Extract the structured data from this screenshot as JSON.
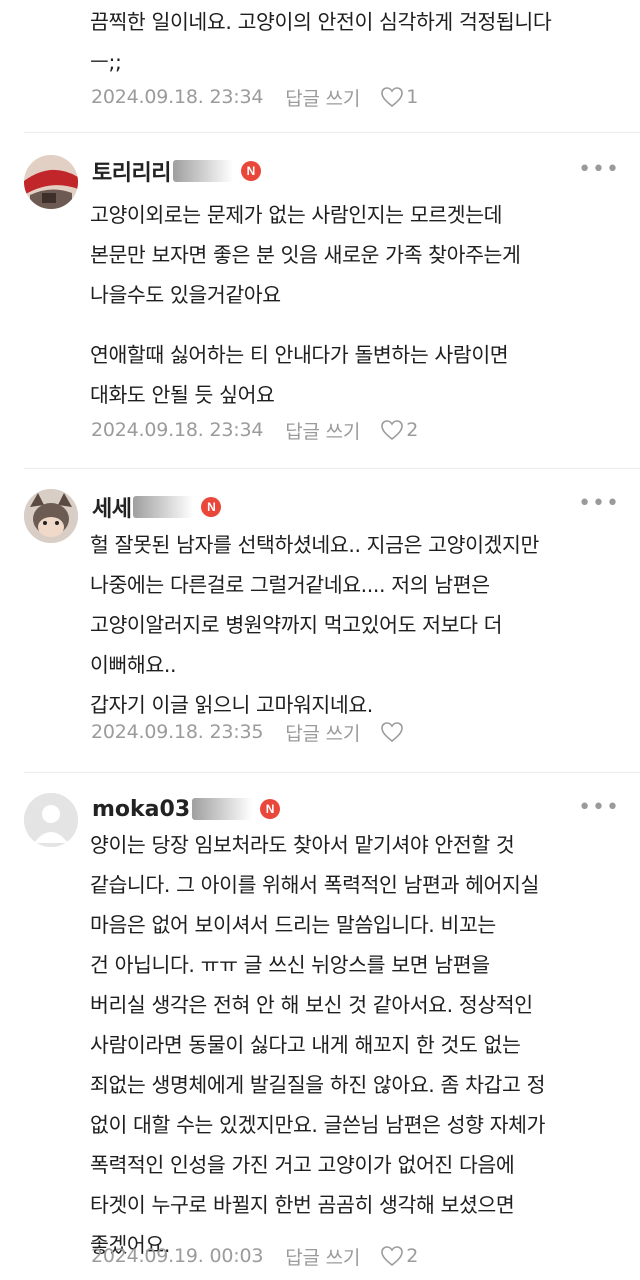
{
  "comments": [
    {
      "lines": [
        "끔찍한 일이네요. 고양이의 안전이 심각하게 걱정됩니다",
        "ㅡ;;"
      ],
      "date": "2024.09.18. 23:34",
      "reply_label": "답글 쓰기",
      "likes": "1"
    },
    {
      "author": "토리리리",
      "badge": "N",
      "lines": [
        "고양이외로는 문제가 없는 사람인지는 모르겟는데",
        "본문만 보자면 좋은 분 잇음 새로운 가족 찾아주는게",
        "나을수도 있을거같아요"
      ],
      "lines2": [
        "연애할때 싫어하는 티 안내다가 돌변하는 사람이면",
        "대화도 안될 듯 싶어요"
      ],
      "date": "2024.09.18. 23:34",
      "reply_label": "답글 쓰기",
      "likes": "2"
    },
    {
      "author": "세세",
      "badge": "N",
      "lines": [
        "헐 잘못된 남자를 선택하셨네요.. 지금은 고양이겠지만",
        "나중에는 다른걸로 그럴거같네요.... 저의 남편은",
        "고양이알러지로 병원약까지 먹고있어도 저보다 더",
        "이뻐해요..",
        "갑자기 이글 읽으니 고마워지네요."
      ],
      "date": "2024.09.18. 23:35",
      "reply_label": "답글 쓰기",
      "likes": ""
    },
    {
      "author": "moka03",
      "badge": "N",
      "lines": [
        "양이는 당장 임보처라도 찾아서 맡기셔야 안전할 것",
        "같습니다. 그 아이를 위해서 폭력적인 남편과 헤어지실",
        "마음은 없어 보이셔서 드리는 말씀입니다. 비꼬는",
        "건 아닙니다. ㅠㅠ 글 쓰신 뉘앙스를 보면 남편을",
        "버리실 생각은 전혀 안 해 보신 것 같아서요. 정상적인",
        "사람이라면 동물이 싫다고 내게 해꼬지 한 것도 없는",
        "죄없는 생명체에게 발길질을 하진 않아요. 좀 차갑고 정",
        "없이 대할 수는 있겠지만요. 글쓴님 남편은 성향 자체가",
        "폭력적인 인성을 가진 거고 고양이가 없어진 다음에",
        "타겟이 누구로 바뀔지 한번 곰곰히 생각해 보셨으면",
        "좋겠어요."
      ],
      "date": "2024.09.19. 00:03",
      "reply_label": "답글 쓰기",
      "likes": "2"
    }
  ],
  "icons": {
    "more": "more-dots-icon",
    "like": "heart-icon",
    "badge": "new-badge-icon"
  },
  "colors": {
    "badge": "#e8473a",
    "meta": "#9b9b9b",
    "divider": "#ececec"
  }
}
